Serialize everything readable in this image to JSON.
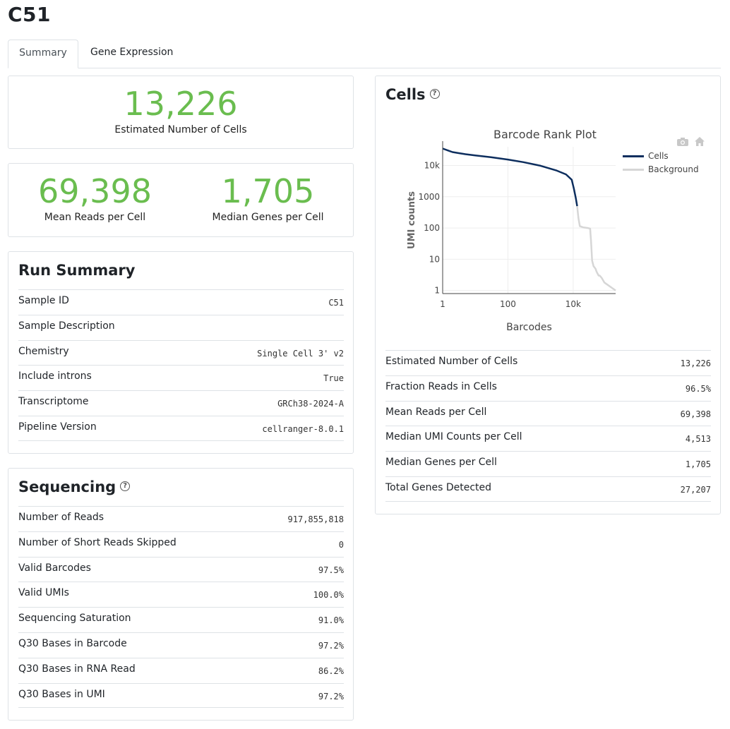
{
  "page": {
    "title": "C51"
  },
  "tabs": [
    {
      "label": "Summary",
      "active": true
    },
    {
      "label": "Gene Expression",
      "active": false
    }
  ],
  "hero": {
    "cells": {
      "value": "13,226",
      "label": "Estimated Number of Cells"
    },
    "reads": {
      "value": "69,398",
      "label": "Mean Reads per Cell"
    },
    "genes": {
      "value": "1,705",
      "label": "Median Genes per Cell"
    }
  },
  "run_summary": {
    "title": "Run Summary",
    "rows": [
      {
        "label": "Sample ID",
        "value": "C51"
      },
      {
        "label": "Sample Description",
        "value": ""
      },
      {
        "label": "Chemistry",
        "value": "Single Cell 3' v2"
      },
      {
        "label": "Include introns",
        "value": "True"
      },
      {
        "label": "Transcriptome",
        "value": "GRCh38-2024-A"
      },
      {
        "label": "Pipeline Version",
        "value": "cellranger-8.0.1"
      }
    ]
  },
  "sequencing": {
    "title": "Sequencing",
    "help": "?",
    "rows": [
      {
        "label": "Number of Reads",
        "value": "917,855,818"
      },
      {
        "label": "Number of Short Reads Skipped",
        "value": "0"
      },
      {
        "label": "Valid Barcodes",
        "value": "97.5%"
      },
      {
        "label": "Valid UMIs",
        "value": "100.0%"
      },
      {
        "label": "Sequencing Saturation",
        "value": "91.0%"
      },
      {
        "label": "Q30 Bases in Barcode",
        "value": "97.2%"
      },
      {
        "label": "Q30 Bases in RNA Read",
        "value": "86.2%"
      },
      {
        "label": "Q30 Bases in UMI",
        "value": "97.2%"
      }
    ]
  },
  "cells": {
    "title": "Cells",
    "help": "?",
    "rows": [
      {
        "label": "Estimated Number of Cells",
        "value": "13,226"
      },
      {
        "label": "Fraction Reads in Cells",
        "value": "96.5%"
      },
      {
        "label": "Mean Reads per Cell",
        "value": "69,398"
      },
      {
        "label": "Median UMI Counts per Cell",
        "value": "4,513"
      },
      {
        "label": "Median Genes per Cell",
        "value": "1,705"
      },
      {
        "label": "Total Genes Detected",
        "value": "27,207"
      }
    ]
  },
  "chart_data": {
    "type": "line",
    "title": "Barcode Rank Plot",
    "xlabel": "Barcodes",
    "ylabel": "UMI counts",
    "x_scale": "log",
    "y_scale": "log",
    "x_ticks": [
      "1",
      "100",
      "10k"
    ],
    "y_ticks": [
      "1",
      "10",
      "100",
      "1000",
      "10k"
    ],
    "grid": true,
    "legend_position": "top-right",
    "series": [
      {
        "name": "Cells",
        "color": "#0d2e5e",
        "x": [
          1,
          1.5,
          2,
          3,
          5,
          10,
          30,
          100,
          300,
          1000,
          3000,
          6000,
          9000,
          10500,
          12000,
          13226
        ],
        "y": [
          35000,
          30000,
          27000,
          25000,
          23000,
          21000,
          18500,
          15500,
          12800,
          9800,
          7000,
          5200,
          3500,
          1800,
          900,
          500
        ]
      },
      {
        "name": "Background",
        "color": "#d6d6d6",
        "x": [
          13226,
          14500,
          16000,
          20000,
          28000,
          33000,
          35000,
          38000,
          42000,
          48000,
          52000,
          60000,
          65000,
          75000,
          90000,
          200000,
          400000
        ],
        "y": [
          500,
          200,
          115,
          105,
          100,
          95,
          40,
          9,
          6,
          5,
          4,
          3,
          3,
          2.5,
          1.8,
          1,
          1
        ]
      }
    ]
  },
  "modebar": {
    "camera": "camera-icon",
    "home": "home-icon"
  }
}
